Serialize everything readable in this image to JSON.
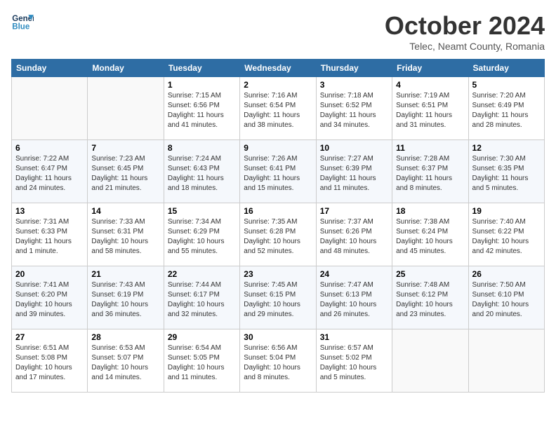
{
  "header": {
    "logo_line1": "General",
    "logo_line2": "Blue",
    "month_title": "October 2024",
    "subtitle": "Telec, Neamt County, Romania"
  },
  "weekdays": [
    "Sunday",
    "Monday",
    "Tuesday",
    "Wednesday",
    "Thursday",
    "Friday",
    "Saturday"
  ],
  "weeks": [
    [
      {
        "day": "",
        "sunrise": "",
        "sunset": "",
        "daylight": ""
      },
      {
        "day": "",
        "sunrise": "",
        "sunset": "",
        "daylight": ""
      },
      {
        "day": "1",
        "sunrise": "Sunrise: 7:15 AM",
        "sunset": "Sunset: 6:56 PM",
        "daylight": "Daylight: 11 hours and 41 minutes."
      },
      {
        "day": "2",
        "sunrise": "Sunrise: 7:16 AM",
        "sunset": "Sunset: 6:54 PM",
        "daylight": "Daylight: 11 hours and 38 minutes."
      },
      {
        "day": "3",
        "sunrise": "Sunrise: 7:18 AM",
        "sunset": "Sunset: 6:52 PM",
        "daylight": "Daylight: 11 hours and 34 minutes."
      },
      {
        "day": "4",
        "sunrise": "Sunrise: 7:19 AM",
        "sunset": "Sunset: 6:51 PM",
        "daylight": "Daylight: 11 hours and 31 minutes."
      },
      {
        "day": "5",
        "sunrise": "Sunrise: 7:20 AM",
        "sunset": "Sunset: 6:49 PM",
        "daylight": "Daylight: 11 hours and 28 minutes."
      }
    ],
    [
      {
        "day": "6",
        "sunrise": "Sunrise: 7:22 AM",
        "sunset": "Sunset: 6:47 PM",
        "daylight": "Daylight: 11 hours and 24 minutes."
      },
      {
        "day": "7",
        "sunrise": "Sunrise: 7:23 AM",
        "sunset": "Sunset: 6:45 PM",
        "daylight": "Daylight: 11 hours and 21 minutes."
      },
      {
        "day": "8",
        "sunrise": "Sunrise: 7:24 AM",
        "sunset": "Sunset: 6:43 PM",
        "daylight": "Daylight: 11 hours and 18 minutes."
      },
      {
        "day": "9",
        "sunrise": "Sunrise: 7:26 AM",
        "sunset": "Sunset: 6:41 PM",
        "daylight": "Daylight: 11 hours and 15 minutes."
      },
      {
        "day": "10",
        "sunrise": "Sunrise: 7:27 AM",
        "sunset": "Sunset: 6:39 PM",
        "daylight": "Daylight: 11 hours and 11 minutes."
      },
      {
        "day": "11",
        "sunrise": "Sunrise: 7:28 AM",
        "sunset": "Sunset: 6:37 PM",
        "daylight": "Daylight: 11 hours and 8 minutes."
      },
      {
        "day": "12",
        "sunrise": "Sunrise: 7:30 AM",
        "sunset": "Sunset: 6:35 PM",
        "daylight": "Daylight: 11 hours and 5 minutes."
      }
    ],
    [
      {
        "day": "13",
        "sunrise": "Sunrise: 7:31 AM",
        "sunset": "Sunset: 6:33 PM",
        "daylight": "Daylight: 11 hours and 1 minute."
      },
      {
        "day": "14",
        "sunrise": "Sunrise: 7:33 AM",
        "sunset": "Sunset: 6:31 PM",
        "daylight": "Daylight: 10 hours and 58 minutes."
      },
      {
        "day": "15",
        "sunrise": "Sunrise: 7:34 AM",
        "sunset": "Sunset: 6:29 PM",
        "daylight": "Daylight: 10 hours and 55 minutes."
      },
      {
        "day": "16",
        "sunrise": "Sunrise: 7:35 AM",
        "sunset": "Sunset: 6:28 PM",
        "daylight": "Daylight: 10 hours and 52 minutes."
      },
      {
        "day": "17",
        "sunrise": "Sunrise: 7:37 AM",
        "sunset": "Sunset: 6:26 PM",
        "daylight": "Daylight: 10 hours and 48 minutes."
      },
      {
        "day": "18",
        "sunrise": "Sunrise: 7:38 AM",
        "sunset": "Sunset: 6:24 PM",
        "daylight": "Daylight: 10 hours and 45 minutes."
      },
      {
        "day": "19",
        "sunrise": "Sunrise: 7:40 AM",
        "sunset": "Sunset: 6:22 PM",
        "daylight": "Daylight: 10 hours and 42 minutes."
      }
    ],
    [
      {
        "day": "20",
        "sunrise": "Sunrise: 7:41 AM",
        "sunset": "Sunset: 6:20 PM",
        "daylight": "Daylight: 10 hours and 39 minutes."
      },
      {
        "day": "21",
        "sunrise": "Sunrise: 7:43 AM",
        "sunset": "Sunset: 6:19 PM",
        "daylight": "Daylight: 10 hours and 36 minutes."
      },
      {
        "day": "22",
        "sunrise": "Sunrise: 7:44 AM",
        "sunset": "Sunset: 6:17 PM",
        "daylight": "Daylight: 10 hours and 32 minutes."
      },
      {
        "day": "23",
        "sunrise": "Sunrise: 7:45 AM",
        "sunset": "Sunset: 6:15 PM",
        "daylight": "Daylight: 10 hours and 29 minutes."
      },
      {
        "day": "24",
        "sunrise": "Sunrise: 7:47 AM",
        "sunset": "Sunset: 6:13 PM",
        "daylight": "Daylight: 10 hours and 26 minutes."
      },
      {
        "day": "25",
        "sunrise": "Sunrise: 7:48 AM",
        "sunset": "Sunset: 6:12 PM",
        "daylight": "Daylight: 10 hours and 23 minutes."
      },
      {
        "day": "26",
        "sunrise": "Sunrise: 7:50 AM",
        "sunset": "Sunset: 6:10 PM",
        "daylight": "Daylight: 10 hours and 20 minutes."
      }
    ],
    [
      {
        "day": "27",
        "sunrise": "Sunrise: 6:51 AM",
        "sunset": "Sunset: 5:08 PM",
        "daylight": "Daylight: 10 hours and 17 minutes."
      },
      {
        "day": "28",
        "sunrise": "Sunrise: 6:53 AM",
        "sunset": "Sunset: 5:07 PM",
        "daylight": "Daylight: 10 hours and 14 minutes."
      },
      {
        "day": "29",
        "sunrise": "Sunrise: 6:54 AM",
        "sunset": "Sunset: 5:05 PM",
        "daylight": "Daylight: 10 hours and 11 minutes."
      },
      {
        "day": "30",
        "sunrise": "Sunrise: 6:56 AM",
        "sunset": "Sunset: 5:04 PM",
        "daylight": "Daylight: 10 hours and 8 minutes."
      },
      {
        "day": "31",
        "sunrise": "Sunrise: 6:57 AM",
        "sunset": "Sunset: 5:02 PM",
        "daylight": "Daylight: 10 hours and 5 minutes."
      },
      {
        "day": "",
        "sunrise": "",
        "sunset": "",
        "daylight": ""
      },
      {
        "day": "",
        "sunrise": "",
        "sunset": "",
        "daylight": ""
      }
    ]
  ]
}
